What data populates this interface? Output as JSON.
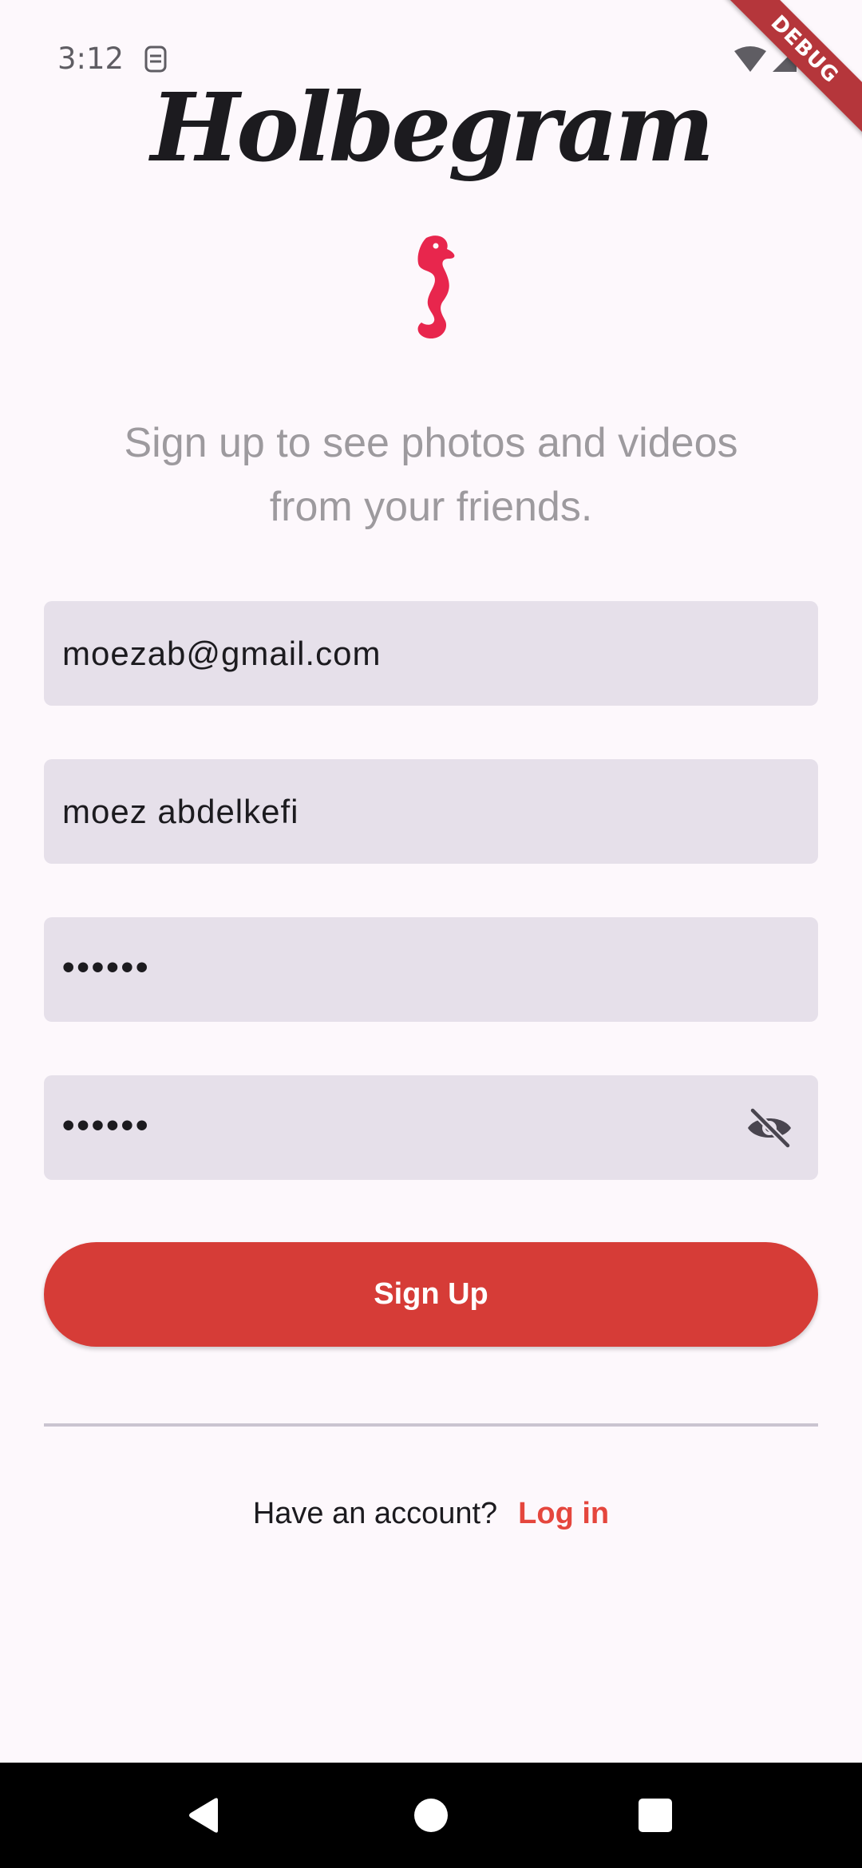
{
  "status_bar": {
    "time": "3:12"
  },
  "debug_banner": "DEBUG",
  "brand": {
    "title": "Holbegram",
    "logo_icon": "seahorse-icon",
    "logo_color": "#e8264d"
  },
  "tagline": "Sign up to see photos and videos from your friends.",
  "form": {
    "email_value": "moezab@gmail.com",
    "name_value": "moez abdelkefi",
    "password_value": "••••••",
    "confirm_password_value": "••••••",
    "visibility_icon": "eye-off-icon"
  },
  "signup_button_label": "Sign Up",
  "footer": {
    "prompt": "Have an account?",
    "login_label": "Log in"
  },
  "colors": {
    "accent": "#d63c37",
    "link": "#e5463d",
    "field_bg": "#e6e0ea",
    "background": "#fdf8fc"
  }
}
